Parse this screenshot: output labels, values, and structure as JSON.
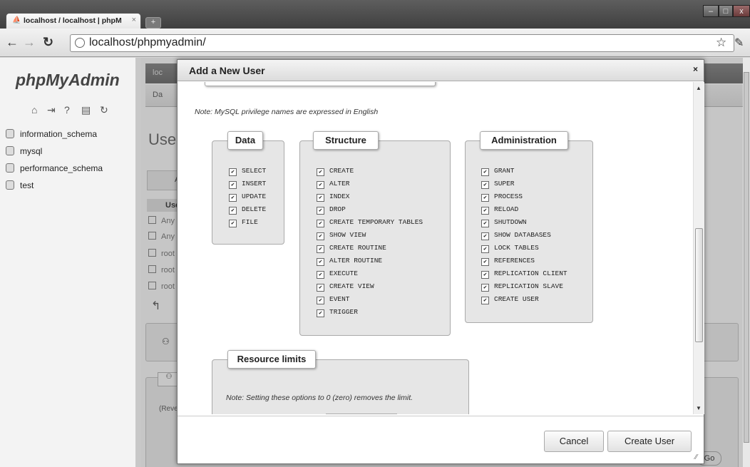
{
  "browser": {
    "tab_title": "localhost / localhost | phpM",
    "tab_close": "×",
    "new_tab": "+",
    "url": "localhost/phpmyadmin/",
    "win_min": "–",
    "win_max": "□",
    "win_close": "x"
  },
  "sidebar": {
    "logo": "phpMyAdmin",
    "databases": [
      "information_schema",
      "mysql",
      "performance_schema",
      "test"
    ]
  },
  "background": {
    "tab_partial_1": "loc",
    "tab_partial_2": "Da",
    "heading_partial": "Use",
    "button_partial": "A",
    "table_header": "Use",
    "rows": [
      "Any",
      "Any",
      "root",
      "root",
      "root"
    ],
    "rev_partial": "(Reve",
    "go_button": "Go"
  },
  "dialog": {
    "title": "Add a New User",
    "close": "×",
    "note_privileges": "Note: MySQL privilege names are expressed in English",
    "groups": {
      "data": {
        "legend": "Data",
        "items": [
          "SELECT",
          "INSERT",
          "UPDATE",
          "DELETE",
          "FILE"
        ]
      },
      "structure": {
        "legend": "Structure",
        "items": [
          "CREATE",
          "ALTER",
          "INDEX",
          "DROP",
          "CREATE TEMPORARY TABLES",
          "SHOW VIEW",
          "CREATE ROUTINE",
          "ALTER ROUTINE",
          "EXECUTE",
          "CREATE VIEW",
          "EVENT",
          "TRIGGER"
        ]
      },
      "administration": {
        "legend": "Administration",
        "items": [
          "GRANT",
          "SUPER",
          "PROCESS",
          "RELOAD",
          "SHUTDOWN",
          "SHOW DATABASES",
          "LOCK TABLES",
          "REFERENCES",
          "REPLICATION CLIENT",
          "REPLICATION SLAVE",
          "CREATE USER"
        ]
      }
    },
    "resource": {
      "legend": "Resource limits",
      "note": "Note: Setting these options to 0 (zero) removes the limit."
    },
    "checked_mark": "✔",
    "cancel_label": "Cancel",
    "create_label": "Create User"
  }
}
